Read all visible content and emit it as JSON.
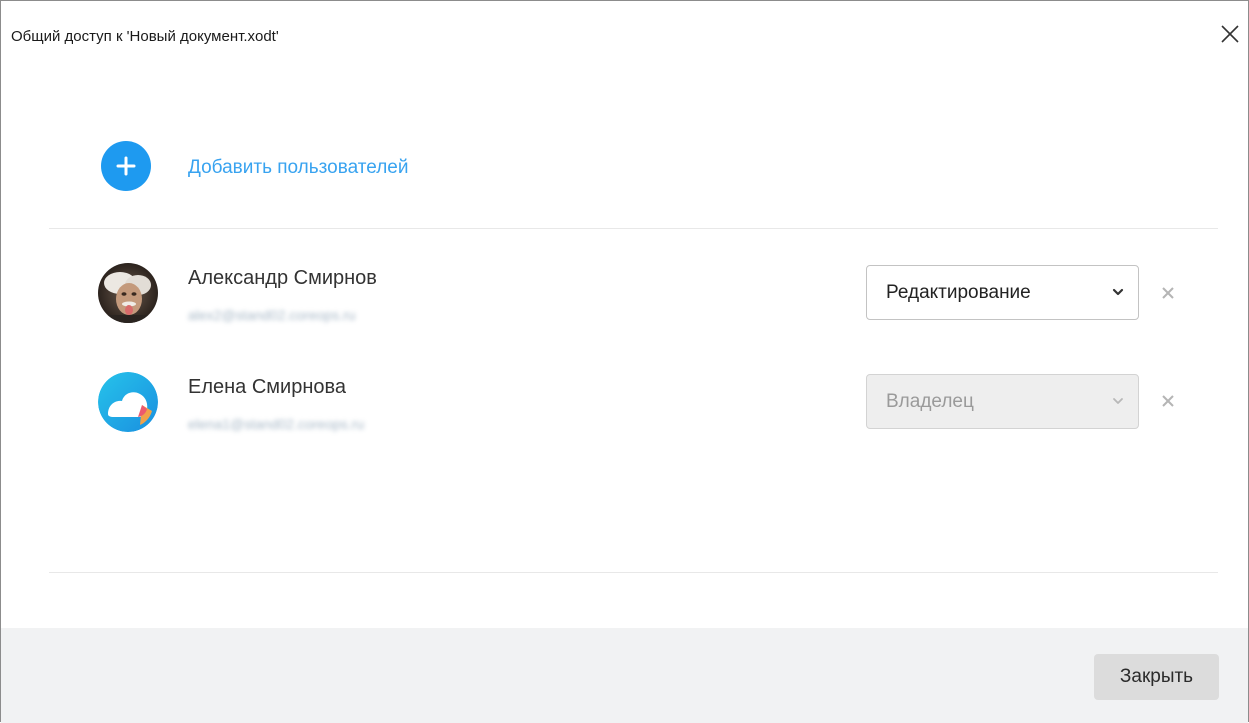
{
  "dialog": {
    "title": "Общий доступ к 'Новый документ.xodt'",
    "close_icon": "close-icon"
  },
  "add_users": {
    "label": "Добавить пользователей",
    "icon": "plus-circle-icon",
    "color": "#1e9af0"
  },
  "users": [
    {
      "name": "Александр Смирнов",
      "email": "alex2@stand02.coreops.ru",
      "role": "Редактирование",
      "role_disabled": false,
      "avatar": "photo-avatar"
    },
    {
      "name": "Елена Смирнова",
      "email": "elena1@stand02.coreops.ru",
      "role": "Владелец",
      "role_disabled": true,
      "avatar": "cloud-logo-avatar"
    }
  ],
  "footer": {
    "close_label": "Закрыть"
  }
}
